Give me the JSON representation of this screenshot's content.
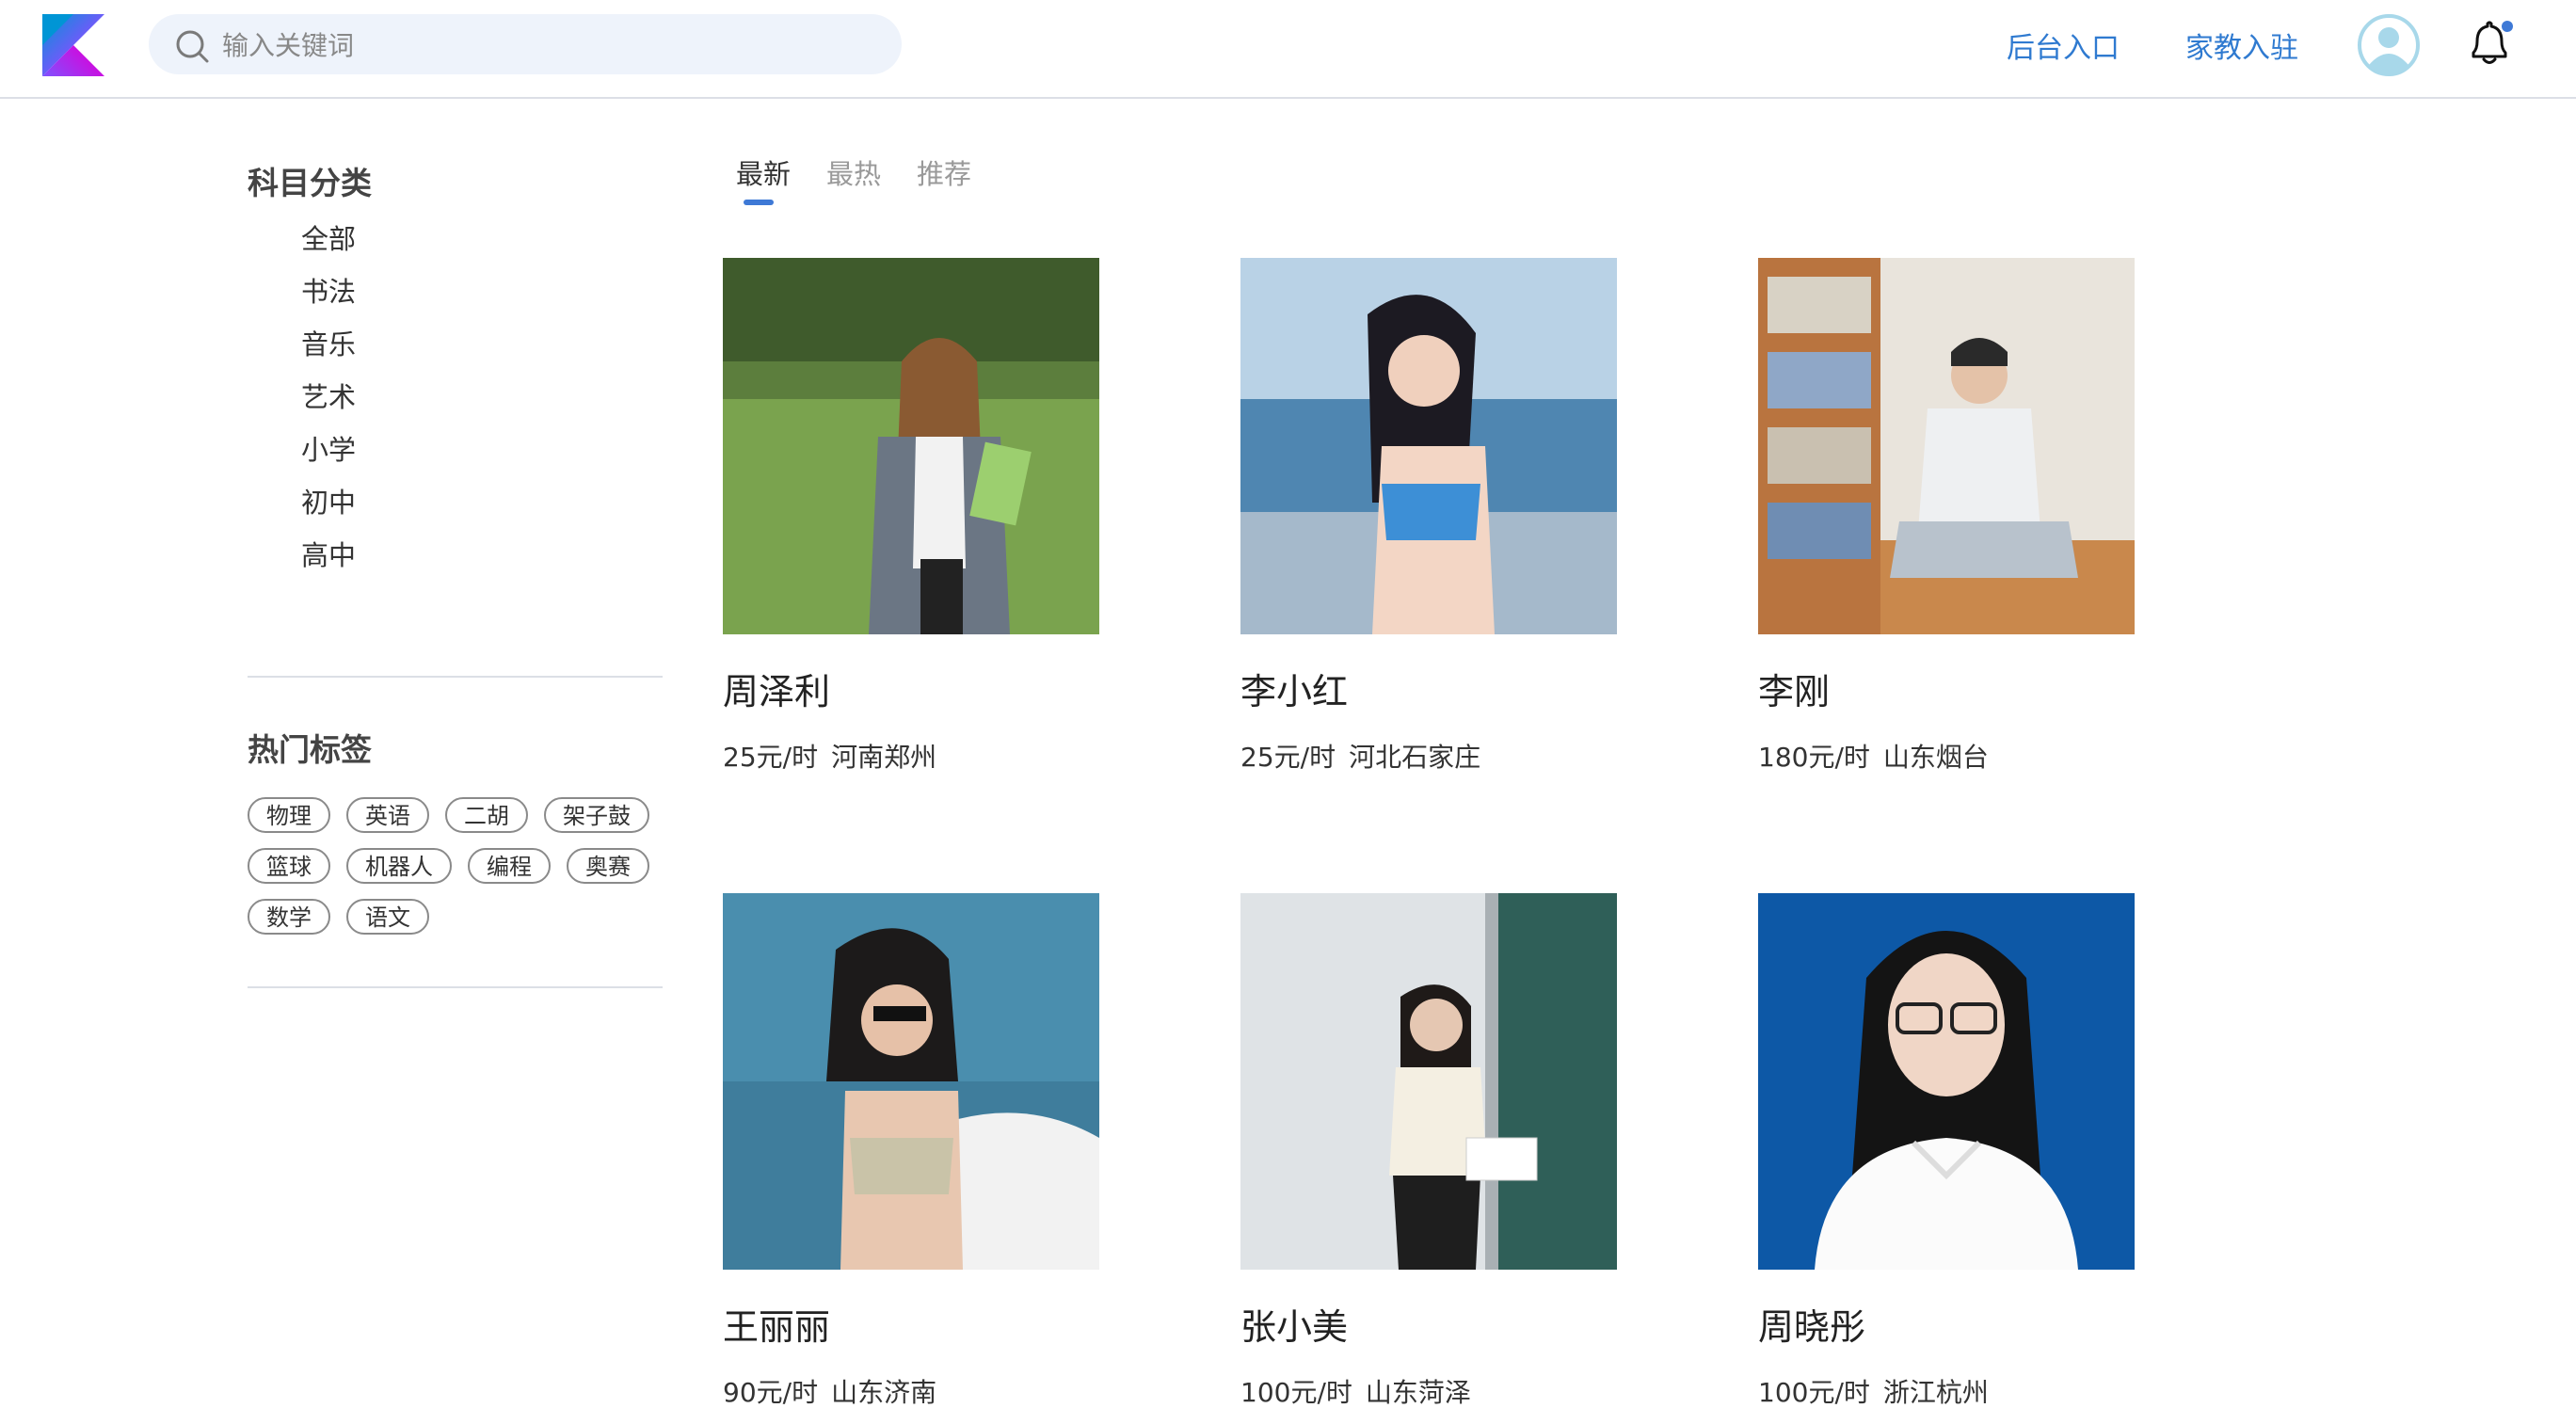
{
  "header": {
    "search_placeholder": "输入关键词",
    "admin_link": "后台入口",
    "tutor_join": "家教入驻"
  },
  "sidebar": {
    "category_title": "科目分类",
    "categories": [
      "全部",
      "书法",
      "音乐",
      "艺术",
      "小学",
      "初中",
      "高中"
    ],
    "hot_tags_title": "热门标签",
    "tags": [
      [
        "物理",
        "英语",
        "二胡",
        "架子鼓"
      ],
      [
        "篮球",
        "机器人",
        "编程",
        "奥赛"
      ],
      [
        "数学",
        "语文"
      ]
    ]
  },
  "tabs": [
    "最新",
    "最热",
    "推荐"
  ],
  "active_tab": "最新",
  "tutors": [
    {
      "name": "周泽利",
      "price": "25元/时",
      "location": "河南郑州"
    },
    {
      "name": "李小红",
      "price": "25元/时",
      "location": "河北石家庄"
    },
    {
      "name": "李刚",
      "price": "180元/时",
      "location": "山东烟台"
    },
    {
      "name": "王丽丽",
      "price": "90元/时",
      "location": "山东济南"
    },
    {
      "name": "张小美",
      "price": "100元/时",
      "location": "山东菏泽"
    },
    {
      "name": "周晓彤",
      "price": "100元/时",
      "location": "浙江杭州"
    }
  ],
  "colors": {
    "accent": "#3e79d6",
    "link": "#2f7ad0",
    "search_bg": "#eef3fb",
    "notification_dot": "#3e79d6"
  },
  "icons": [
    "kotlin-logo",
    "search-icon",
    "user-avatar-icon",
    "bell-icon"
  ]
}
